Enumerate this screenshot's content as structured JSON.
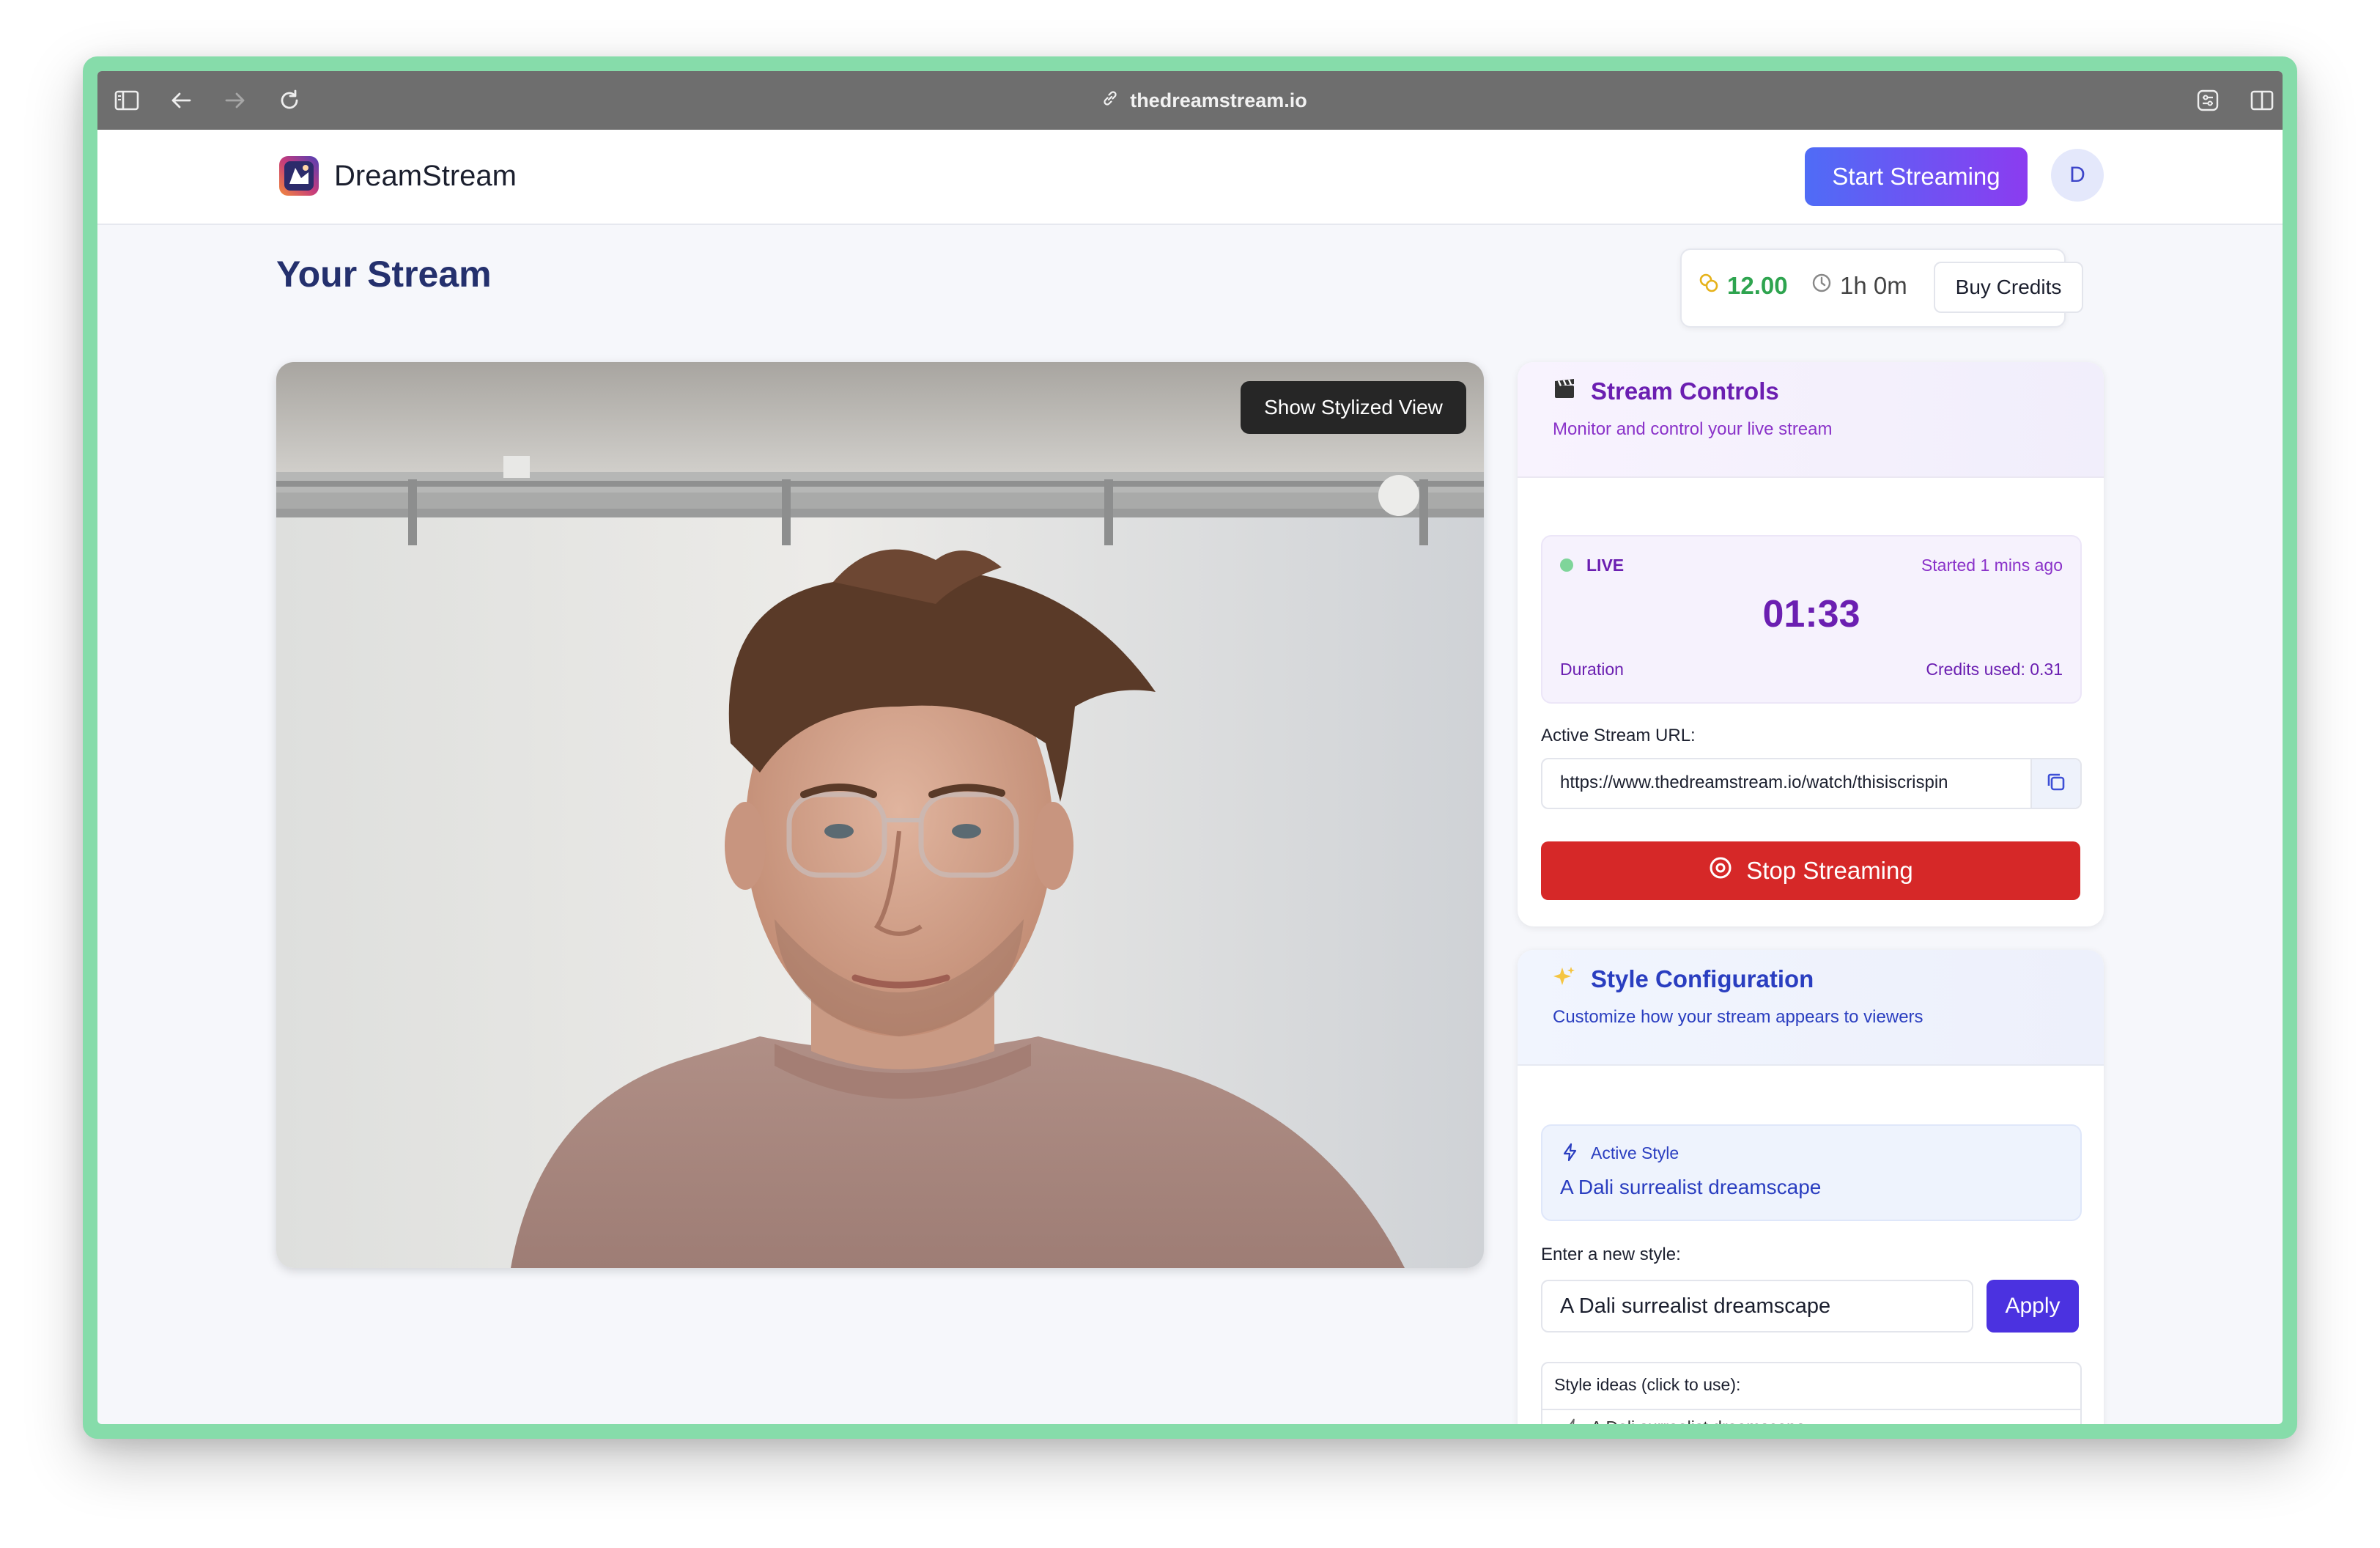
{
  "browser": {
    "url": "thedreamstream.io"
  },
  "app": {
    "brand": "DreamStream",
    "start_streaming": "Start Streaming",
    "avatar_initial": "D"
  },
  "page": {
    "title": "Your Stream"
  },
  "credits": {
    "amount": "12.00",
    "time": "1h 0m",
    "buy_label": "Buy Credits"
  },
  "video": {
    "toggle_label": "Show Stylized View"
  },
  "stream_controls": {
    "title": "Stream Controls",
    "subtitle": "Monitor and control your live stream",
    "status": "LIVE",
    "started": "Started 1 mins ago",
    "timer": "01:33",
    "duration_label": "Duration",
    "credits_used": "Credits used: 0.31",
    "url_label": "Active Stream URL:",
    "url_value": "https://www.thedreamstream.io/watch/thisiscrispin",
    "stop_label": "Stop Streaming"
  },
  "style_config": {
    "title": "Style Configuration",
    "subtitle": "Customize how your stream appears to viewers",
    "active_label": "Active Style",
    "active_value": "A Dali surrealist dreamscape",
    "new_style_label": "Enter a new style:",
    "new_style_value": "A Dali surrealist dreamscape",
    "apply_label": "Apply",
    "ideas_label": "Style ideas (click to use):",
    "ideas": [
      "A Dali surrealist dreamscape"
    ]
  },
  "colors": {
    "primary_gradient_start": "#4f6cf6",
    "primary_gradient_end": "#8b3cf0",
    "stop_red": "#d62828",
    "apply_indigo": "#4b32e0",
    "live_green": "#4cc46b",
    "purple_text": "#6b1fb1",
    "blue_text": "#2a3ec0"
  }
}
